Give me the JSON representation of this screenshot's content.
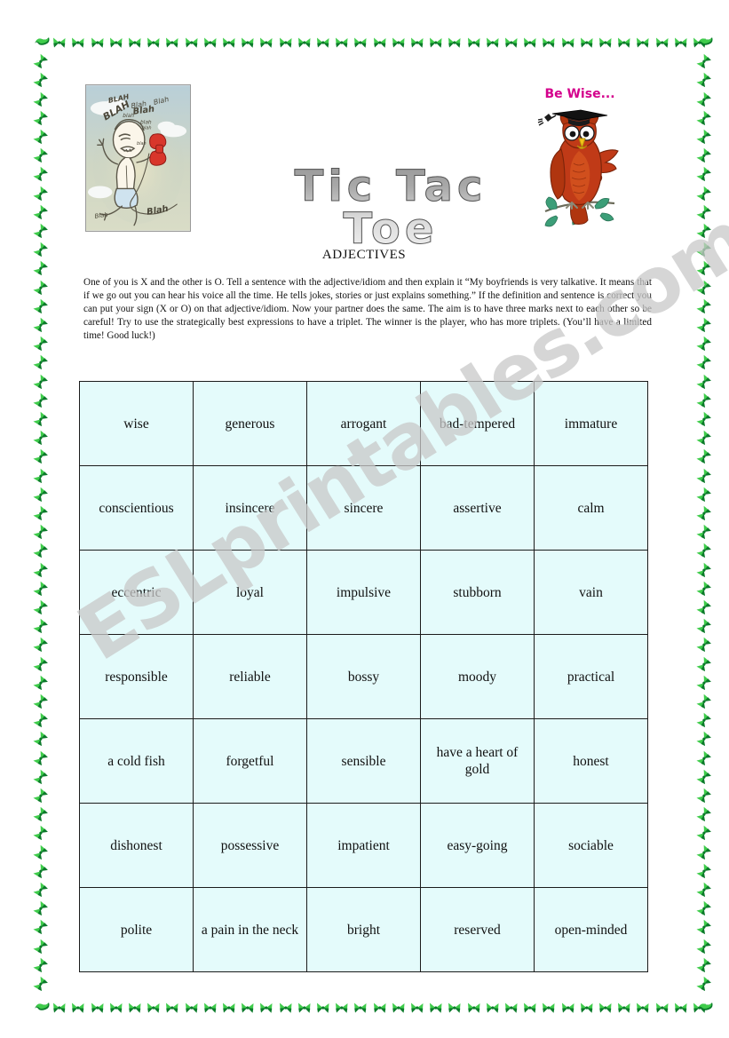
{
  "page": {
    "title": "Tic Tac Toe",
    "subtitle": "ADJECTIVES",
    "watermark": "ESLprintables.com",
    "instructions": "One of you is X and the other is O. Tell a sentence with the adjective/idiom and then explain it “My boyfriends is very talkative. It means that if we go out you can hear his voice all the time. He tells jokes, stories or just explains something.” If the definition and sentence is correct you can put your sign (X or O) on that adjective/idiom. Now your partner does the same. The aim is to have three marks next to each other so be careful! Try to use the strategically best expressions to have a triplet. The winner is the player, who has more triplets. (You’ll have a limited time! Good luck!)"
  },
  "illustrations": {
    "left": {
      "name": "talkative-person-on-phone",
      "speech_words": [
        "BLAH",
        "Blah",
        "blah",
        "Blah",
        "Blah",
        "blah",
        "Blah",
        "Blah"
      ]
    },
    "right": {
      "name": "graduate-owl",
      "caption": "Be Wise..."
    }
  },
  "colors": {
    "cell_background": "#e4fbfb",
    "cell_border": "#1b1b1b",
    "caption_pink": "#d4008c",
    "border_green_light": "#3fcc4b",
    "border_green_dark": "#0b7a2a",
    "watermark_gray": "#c9c9c9",
    "owl_body": "#c03a17",
    "owl_body_light": "#d4541f",
    "leaf_green": "#3c9e78"
  },
  "grid": {
    "columns": 5,
    "rows": 7,
    "cells": [
      [
        "wise",
        "generous",
        "arrogant",
        "bad-tempered",
        "immature"
      ],
      [
        "conscientious",
        "insincere",
        "sincere",
        "assertive",
        "calm"
      ],
      [
        "eccentric",
        "loyal",
        "impulsive",
        "stubborn",
        "vain"
      ],
      [
        "responsible",
        "reliable",
        "bossy",
        "moody",
        "practical"
      ],
      [
        "a cold fish",
        "forgetful",
        "sensible",
        "have a heart of gold",
        "honest"
      ],
      [
        "dishonest",
        "possessive",
        "impatient",
        "easy-going",
        "sociable"
      ],
      [
        "polite",
        "a pain in the neck",
        "bright",
        "reserved",
        "open-minded"
      ]
    ]
  }
}
